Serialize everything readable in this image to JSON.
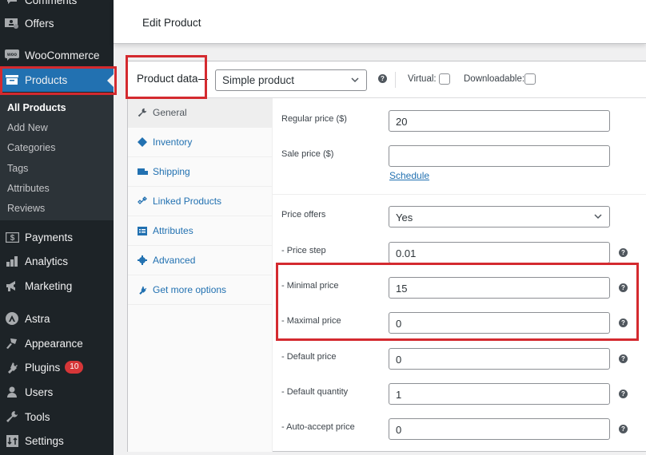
{
  "sidebar": {
    "items": [
      {
        "label": "Comments",
        "icon": "comments-icon"
      },
      {
        "label": "Offers",
        "icon": "offers-icon"
      },
      {
        "label": "WooCommerce",
        "icon": "woocommerce-icon"
      },
      {
        "label": "Products",
        "icon": "archive-box-icon",
        "active": true
      },
      {
        "label": "Payments",
        "icon": "payments-icon"
      },
      {
        "label": "Analytics",
        "icon": "bar-chart-icon"
      },
      {
        "label": "Marketing",
        "icon": "megaphone-icon"
      },
      {
        "label": "Astra",
        "icon": "astra-logo-icon"
      },
      {
        "label": "Appearance",
        "icon": "paintbrush-icon"
      },
      {
        "label": "Plugins",
        "icon": "plug-icon",
        "badge": "10"
      },
      {
        "label": "Users",
        "icon": "user-icon"
      },
      {
        "label": "Tools",
        "icon": "wrench-icon"
      },
      {
        "label": "Settings",
        "icon": "settings-icon"
      }
    ],
    "submenu": [
      "All Products",
      "Add New",
      "Categories",
      "Tags",
      "Attributes",
      "Reviews"
    ],
    "current_submenu": "All Products"
  },
  "header": {
    "title": "Edit Product"
  },
  "product_data": {
    "title": "Product data",
    "type_select": "Simple product",
    "virtual_label": "Virtual:",
    "virtual_checked": false,
    "downloadable_label": "Downloadable:",
    "downloadable_checked": false
  },
  "tabs": [
    {
      "label": "General",
      "icon": "wrench-icon",
      "active": true
    },
    {
      "label": "Inventory",
      "icon": "inventory-tag-icon"
    },
    {
      "label": "Shipping",
      "icon": "truck-icon"
    },
    {
      "label": "Linked Products",
      "icon": "link-icon"
    },
    {
      "label": "Attributes",
      "icon": "list-card-icon"
    },
    {
      "label": "Advanced",
      "icon": "gear-icon"
    },
    {
      "label": "Get more options",
      "icon": "plug-icon"
    }
  ],
  "fields": {
    "regular_price": {
      "label": "Regular price ($)",
      "value": "20"
    },
    "sale_price": {
      "label": "Sale price ($)",
      "value": ""
    },
    "schedule_link": "Schedule",
    "price_offers": {
      "label": "Price offers",
      "value": "Yes"
    },
    "price_step": {
      "label": "- Price step",
      "value": "0.01"
    },
    "minimal_price": {
      "label": "- Minimal price",
      "value": "15"
    },
    "maximal_price": {
      "label": "- Maximal price",
      "value": "0"
    },
    "default_price": {
      "label": "- Default price",
      "value": "0"
    },
    "default_quantity": {
      "label": "- Default quantity",
      "value": "1"
    },
    "auto_accept_price": {
      "label": "- Auto-accept price",
      "value": "0"
    }
  },
  "colors": {
    "accent": "#2271b1",
    "highlight": "#d42a2f",
    "sidebar_bg": "#1d2327",
    "badge": "#d63638"
  }
}
